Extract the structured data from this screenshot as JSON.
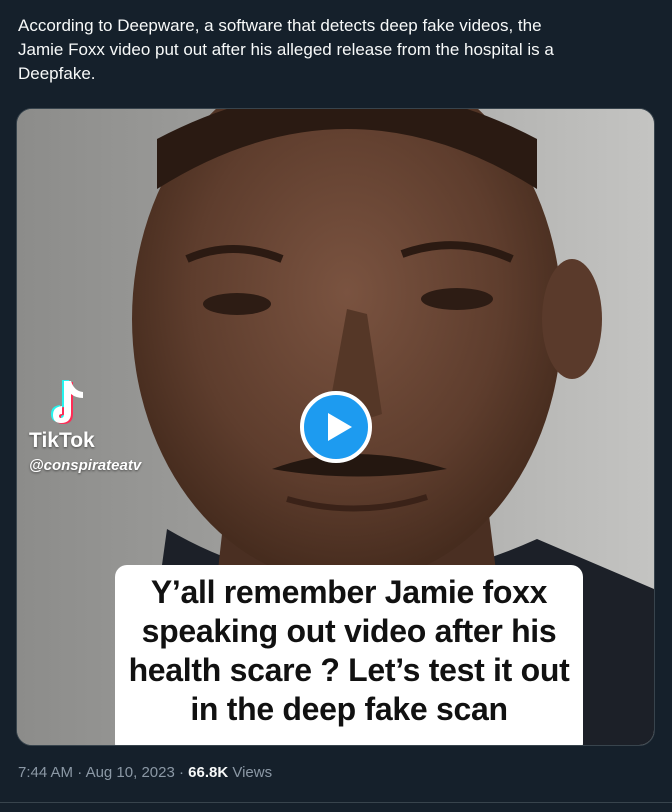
{
  "tweet": {
    "text": "According to Deepware, a software that detects deep fake videos, the\nJamie Foxx video put out after his alleged release from the hospital is a\nDeepfake."
  },
  "media": {
    "icon": "play-icon",
    "tiktok": {
      "brand": "TikTok",
      "handle": "@conspirateatv",
      "icon": "tiktok-logo-icon"
    },
    "caption_lines": [
      "Y’all remember Jamie foxx",
      "speaking out video after his",
      "health scare ? Let’s test it out",
      "in the deep fake scan"
    ]
  },
  "meta": {
    "time": "7:44 AM",
    "sep1": " · ",
    "date": "Aug 10, 2023",
    "sep2": " · ",
    "views_count": "66.8K",
    "views_label": " Views"
  },
  "colors": {
    "background": "#15202b",
    "text": "#f7f9f9",
    "secondary": "#8b98a5",
    "accent": "#1d9bf0"
  }
}
